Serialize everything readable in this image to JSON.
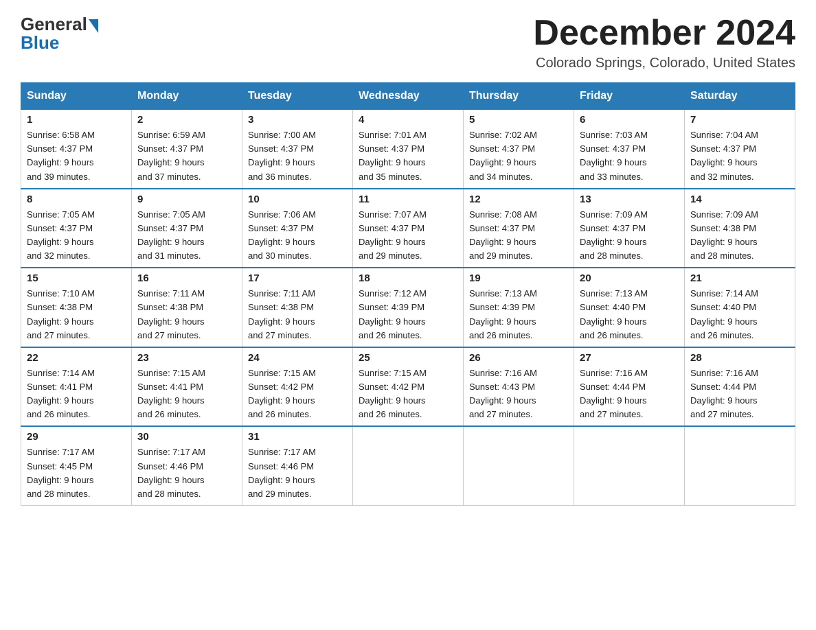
{
  "logo": {
    "general": "General",
    "blue": "Blue"
  },
  "title": {
    "month_year": "December 2024",
    "location": "Colorado Springs, Colorado, United States"
  },
  "days_of_week": [
    "Sunday",
    "Monday",
    "Tuesday",
    "Wednesday",
    "Thursday",
    "Friday",
    "Saturday"
  ],
  "weeks": [
    [
      {
        "day": "1",
        "sunrise": "6:58 AM",
        "sunset": "4:37 PM",
        "daylight": "9 hours and 39 minutes."
      },
      {
        "day": "2",
        "sunrise": "6:59 AM",
        "sunset": "4:37 PM",
        "daylight": "9 hours and 37 minutes."
      },
      {
        "day": "3",
        "sunrise": "7:00 AM",
        "sunset": "4:37 PM",
        "daylight": "9 hours and 36 minutes."
      },
      {
        "day": "4",
        "sunrise": "7:01 AM",
        "sunset": "4:37 PM",
        "daylight": "9 hours and 35 minutes."
      },
      {
        "day": "5",
        "sunrise": "7:02 AM",
        "sunset": "4:37 PM",
        "daylight": "9 hours and 34 minutes."
      },
      {
        "day": "6",
        "sunrise": "7:03 AM",
        "sunset": "4:37 PM",
        "daylight": "9 hours and 33 minutes."
      },
      {
        "day": "7",
        "sunrise": "7:04 AM",
        "sunset": "4:37 PM",
        "daylight": "9 hours and 32 minutes."
      }
    ],
    [
      {
        "day": "8",
        "sunrise": "7:05 AM",
        "sunset": "4:37 PM",
        "daylight": "9 hours and 32 minutes."
      },
      {
        "day": "9",
        "sunrise": "7:05 AM",
        "sunset": "4:37 PM",
        "daylight": "9 hours and 31 minutes."
      },
      {
        "day": "10",
        "sunrise": "7:06 AM",
        "sunset": "4:37 PM",
        "daylight": "9 hours and 30 minutes."
      },
      {
        "day": "11",
        "sunrise": "7:07 AM",
        "sunset": "4:37 PM",
        "daylight": "9 hours and 29 minutes."
      },
      {
        "day": "12",
        "sunrise": "7:08 AM",
        "sunset": "4:37 PM",
        "daylight": "9 hours and 29 minutes."
      },
      {
        "day": "13",
        "sunrise": "7:09 AM",
        "sunset": "4:37 PM",
        "daylight": "9 hours and 28 minutes."
      },
      {
        "day": "14",
        "sunrise": "7:09 AM",
        "sunset": "4:38 PM",
        "daylight": "9 hours and 28 minutes."
      }
    ],
    [
      {
        "day": "15",
        "sunrise": "7:10 AM",
        "sunset": "4:38 PM",
        "daylight": "9 hours and 27 minutes."
      },
      {
        "day": "16",
        "sunrise": "7:11 AM",
        "sunset": "4:38 PM",
        "daylight": "9 hours and 27 minutes."
      },
      {
        "day": "17",
        "sunrise": "7:11 AM",
        "sunset": "4:38 PM",
        "daylight": "9 hours and 27 minutes."
      },
      {
        "day": "18",
        "sunrise": "7:12 AM",
        "sunset": "4:39 PM",
        "daylight": "9 hours and 26 minutes."
      },
      {
        "day": "19",
        "sunrise": "7:13 AM",
        "sunset": "4:39 PM",
        "daylight": "9 hours and 26 minutes."
      },
      {
        "day": "20",
        "sunrise": "7:13 AM",
        "sunset": "4:40 PM",
        "daylight": "9 hours and 26 minutes."
      },
      {
        "day": "21",
        "sunrise": "7:14 AM",
        "sunset": "4:40 PM",
        "daylight": "9 hours and 26 minutes."
      }
    ],
    [
      {
        "day": "22",
        "sunrise": "7:14 AM",
        "sunset": "4:41 PM",
        "daylight": "9 hours and 26 minutes."
      },
      {
        "day": "23",
        "sunrise": "7:15 AM",
        "sunset": "4:41 PM",
        "daylight": "9 hours and 26 minutes."
      },
      {
        "day": "24",
        "sunrise": "7:15 AM",
        "sunset": "4:42 PM",
        "daylight": "9 hours and 26 minutes."
      },
      {
        "day": "25",
        "sunrise": "7:15 AM",
        "sunset": "4:42 PM",
        "daylight": "9 hours and 26 minutes."
      },
      {
        "day": "26",
        "sunrise": "7:16 AM",
        "sunset": "4:43 PM",
        "daylight": "9 hours and 27 minutes."
      },
      {
        "day": "27",
        "sunrise": "7:16 AM",
        "sunset": "4:44 PM",
        "daylight": "9 hours and 27 minutes."
      },
      {
        "day": "28",
        "sunrise": "7:16 AM",
        "sunset": "4:44 PM",
        "daylight": "9 hours and 27 minutes."
      }
    ],
    [
      {
        "day": "29",
        "sunrise": "7:17 AM",
        "sunset": "4:45 PM",
        "daylight": "9 hours and 28 minutes."
      },
      {
        "day": "30",
        "sunrise": "7:17 AM",
        "sunset": "4:46 PM",
        "daylight": "9 hours and 28 minutes."
      },
      {
        "day": "31",
        "sunrise": "7:17 AM",
        "sunset": "4:46 PM",
        "daylight": "9 hours and 29 minutes."
      },
      null,
      null,
      null,
      null
    ]
  ],
  "labels": {
    "sunrise": "Sunrise:",
    "sunset": "Sunset:",
    "daylight": "Daylight:"
  }
}
